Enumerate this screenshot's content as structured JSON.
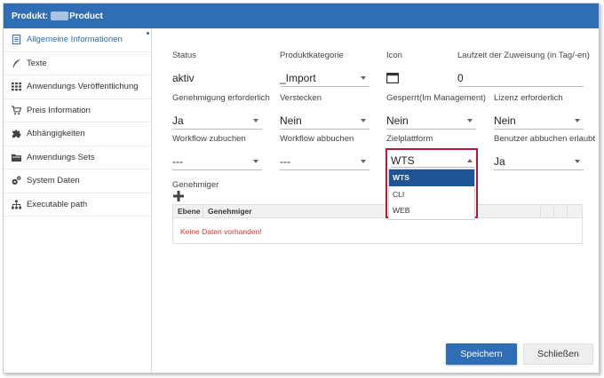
{
  "header": {
    "title_prefix": "Produkt:",
    "title_suffix": "Product"
  },
  "sidebar": {
    "items": [
      {
        "label": "Allgemeine Informationen",
        "icon": "document-icon"
      },
      {
        "label": "Texte",
        "icon": "feather-icon"
      },
      {
        "label": "Anwendungs Veröffentlichung",
        "icon": "grid-icon"
      },
      {
        "label": "Preis Information",
        "icon": "cart-icon"
      },
      {
        "label": "Abhängigkeiten",
        "icon": "puzzle-icon"
      },
      {
        "label": "Anwendungs Sets",
        "icon": "folder-icon"
      },
      {
        "label": "System Daten",
        "icon": "gears-icon"
      },
      {
        "label": "Executable path",
        "icon": "sitemap-icon"
      }
    ]
  },
  "form": {
    "status": {
      "label": "Status",
      "value": "aktiv"
    },
    "produktkategorie": {
      "label": "Produktkategorie",
      "value": "_Import"
    },
    "icon": {
      "label": "Icon"
    },
    "laufzeit": {
      "label": "Laufzeit der Zuweisung (in Tag/-en)",
      "value": "0"
    },
    "genehmigung": {
      "label": "Genehmigung erforderlich",
      "value": "Ja"
    },
    "verstecken": {
      "label": "Verstecken",
      "value": "Nein"
    },
    "gesperrt": {
      "label": "Gesperrt(Im Management)",
      "value": "Nein"
    },
    "lizenz": {
      "label": "Lizenz erforderlich",
      "value": "Nein"
    },
    "workflow_zubuchen": {
      "label": "Workflow zubuchen",
      "value": "---"
    },
    "workflow_abbuchen": {
      "label": "Workflow abbuchen",
      "value": "---"
    },
    "zielplattform": {
      "label": "Zielplattform",
      "value": "WTS",
      "options": [
        "WTS",
        "CLI",
        "WEB"
      ]
    },
    "benutzer_abbuchen": {
      "label": "Benutzer abbuchen erlaubt",
      "value": "Ja"
    }
  },
  "genehmiger": {
    "label": "Genehmiger",
    "columns": [
      "Ebene",
      "Genehmiger"
    ],
    "empty_text": "Keine Daten vorhanden!"
  },
  "buttons": {
    "save": "Speichern",
    "close": "Schließen"
  },
  "colors": {
    "primary": "#2f6eb5",
    "selected_option": "#1f5494",
    "highlight": "#b4183a",
    "error_text": "#d9352b"
  }
}
